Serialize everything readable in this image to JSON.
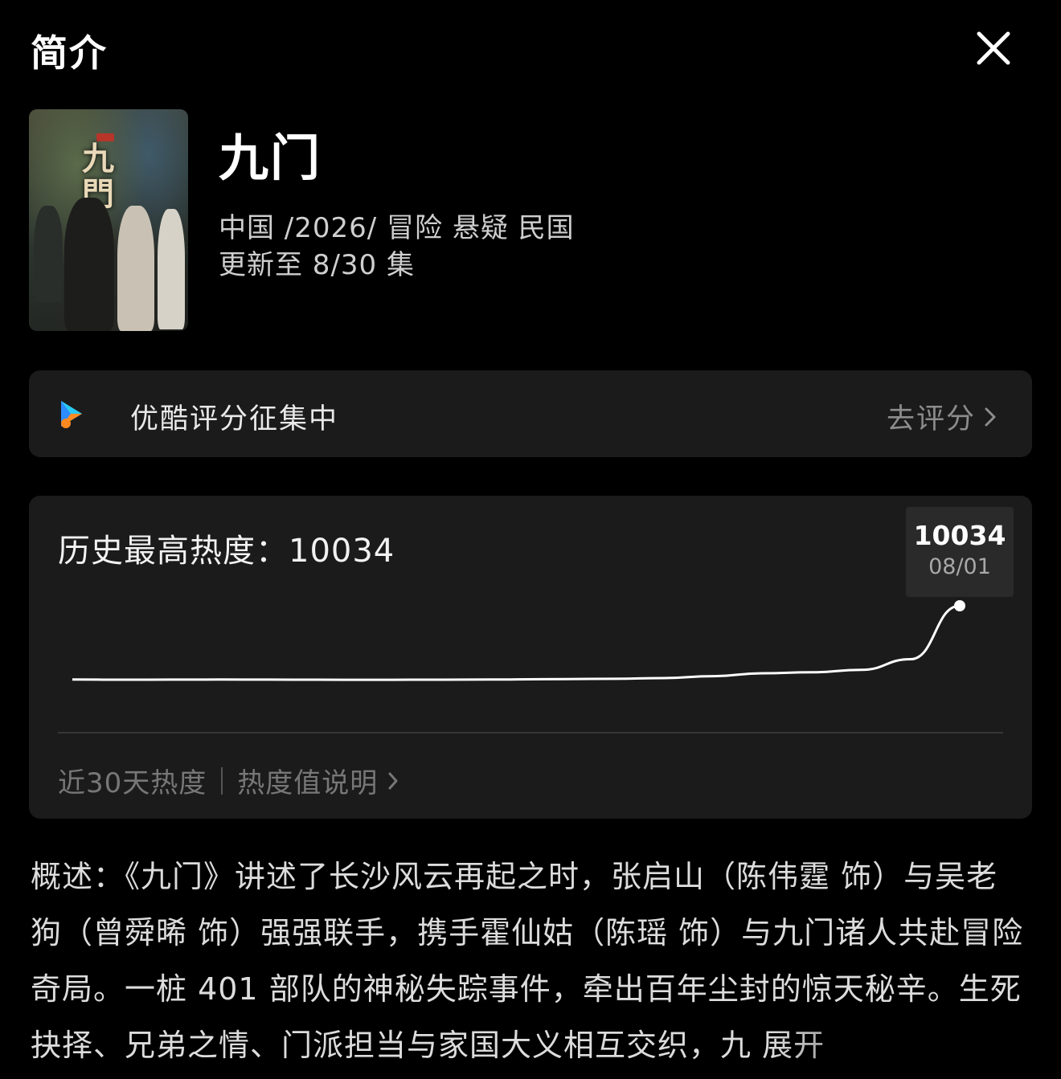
{
  "header": {
    "title": "简介",
    "close_icon": "close-icon"
  },
  "show": {
    "title": "九门",
    "poster_title": "九門",
    "meta_line1": "中国 /2026/ 冒险 悬疑 民国",
    "meta_line2": "更新至 8/30 集"
  },
  "rating": {
    "label": "优酷评分征集中",
    "action": "去评分",
    "logo_icon": "youku-logo-icon",
    "colors": {
      "orange": "#ff8a1f",
      "blue": "#2d8cff",
      "cyan": "#29c9f0"
    }
  },
  "heat": {
    "title_label": "历史最高热度：",
    "peak_value": "10034",
    "tooltip_value": "10034",
    "tooltip_date": "08/01",
    "footer_left": "近30天热度",
    "footer_link": "热度值说明"
  },
  "chart_data": {
    "type": "line",
    "series": [
      {
        "values": [
          2400,
          2380,
          2390,
          2400,
          2390,
          2380,
          2370,
          2380,
          2390,
          2410,
          2450,
          2480,
          2550,
          2750,
          3050,
          3150,
          3400,
          4500,
          10034
        ]
      }
    ],
    "highlight_index": 18,
    "grid": false
  },
  "description": {
    "text": "概述：《九门》讲述了长沙风云再起之时，张启山（陈伟霆 饰）与吴老狗（曾舜晞 饰）强强联手，携手霍仙姑（陈瑶 饰）与九门诸人共赴冒险奇局。一桩 401 部队的神秘失踪事件，牵出百年尘封的惊天秘辛。生死抉择、兄弟之情、门派担当与家国大义相互交织，九 展开"
  }
}
